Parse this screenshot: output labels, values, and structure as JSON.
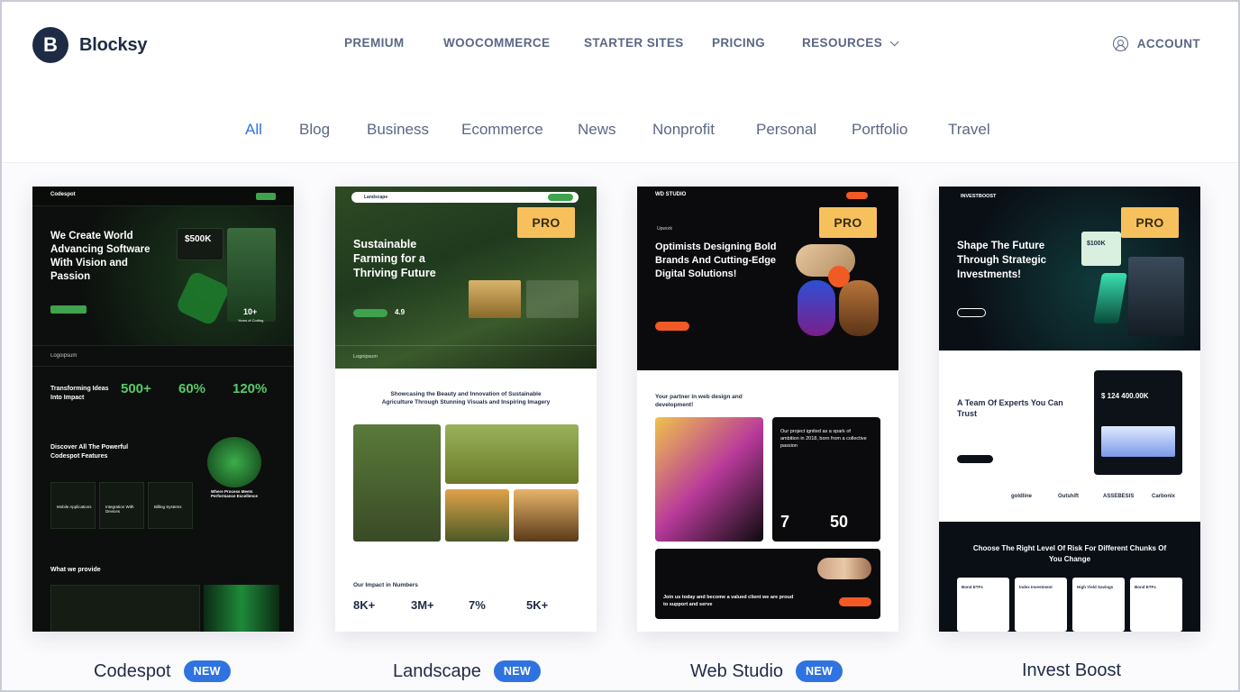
{
  "brand": {
    "name": "Blocksy",
    "mark": "B"
  },
  "nav": {
    "items": [
      "PREMIUM",
      "WOOCOMMERCE",
      "STARTER SITES",
      "PRICING",
      "RESOURCES"
    ],
    "account": "ACCOUNT"
  },
  "filters": [
    "All",
    "Blog",
    "Business",
    "Ecommerce",
    "News",
    "Nonprofit",
    "Personal",
    "Portfolio",
    "Travel"
  ],
  "active_filter": "All",
  "colors": {
    "accent": "#2f73e0",
    "pro": "#f6c15d",
    "brand_dark": "#1f2b45"
  },
  "cards": [
    {
      "name": "Codespot",
      "badge": "NEW",
      "preview": {
        "logo": "Codespot",
        "headline": "We Create World Advancing Software With Vision and Passion",
        "stat_money": "$500K",
        "stat_years": "10+",
        "stat_years_label": "Years of Coding",
        "logo_row": "Logoipsum",
        "section_title": "Transforming Ideas Into Impact",
        "stats": [
          "500+",
          "60%",
          "120%"
        ],
        "features_title": "Discover All The Powerful Codespot Features",
        "feature_cards": [
          "Mobile Applications",
          "Integration With Devices",
          "Billing Systems"
        ],
        "feature_note": "Where Process Meets Performance Excellence",
        "what_title": "What we provide"
      }
    },
    {
      "name": "Landscape",
      "badge": "NEW",
      "pro": "PRO",
      "preview": {
        "logo": "Landscape",
        "headline": "Sustainable Farming for a Thriving Future",
        "rating": "4.9",
        "logo_row": "Logoipsum",
        "section_title": "Showcasing the Beauty and Innovation of Sustainable Agriculture Through Stunning Visuals and Inspiring Imagery",
        "impact_title": "Our Impact in Numbers",
        "impact_stats": [
          "8K+",
          "3M+",
          "7%",
          "5K+"
        ]
      }
    },
    {
      "name": "Web Studio",
      "badge": "NEW",
      "pro": "PRO",
      "preview": {
        "logo": "WD STUDIO",
        "eyebrow": "Upwork",
        "headline": "Optimists Designing Bold Brands And Cutting-Edge Digital Solutions!",
        "partner_title": "Your partner in web design and development!",
        "project_text": "Our project ignited as a spark of ambition in 2018, born from a collective passion",
        "stats": [
          "7",
          "50"
        ],
        "join_text": "Join us today and become a valued client we are proud to support and serve"
      }
    },
    {
      "name": "Invest Boost",
      "pro": "PRO",
      "preview": {
        "logo": "INVESTBOOST",
        "headline": "Shape The Future Through Strategic Investments!",
        "stat_money": "$100K",
        "team_title": "A Team Of Experts You Can Trust",
        "balance": "$ 124 400.00K",
        "partners": [
          "goldline",
          "Outshift",
          "ASSEBESIS",
          "Carbonix"
        ],
        "risk_title": "Choose The Right Level Of Risk For Different Chunks Of You Change",
        "risk_cards": [
          "Bond ETFs",
          "Index Investment",
          "High Yield Savings",
          "Bond ETFs"
        ]
      }
    }
  ]
}
